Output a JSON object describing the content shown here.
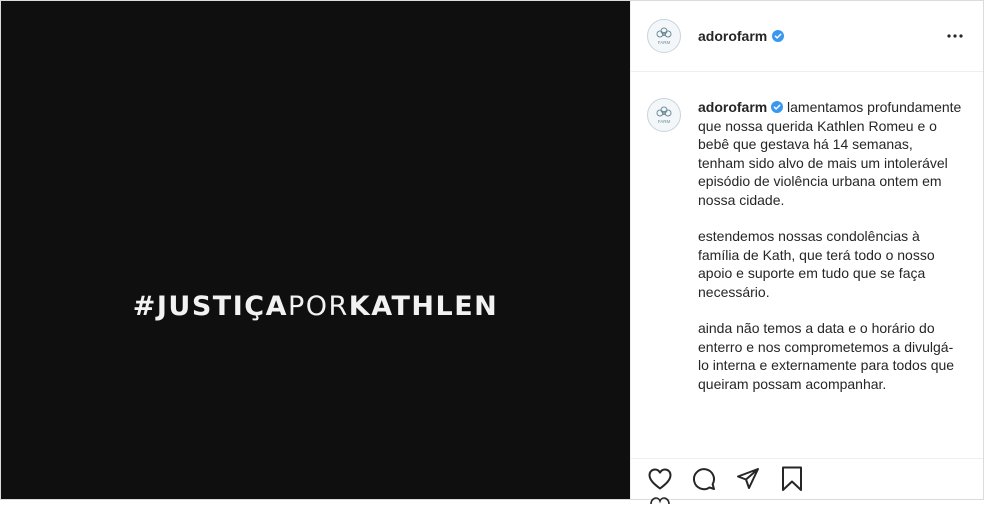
{
  "post": {
    "username": "adorofarm",
    "avatar_text": "FARM",
    "verified": true,
    "image_text_bold_1": "#JUSTIÇA",
    "image_text_thin": "POR",
    "image_text_bold_2": "KATHLEN",
    "caption_paragraphs": [
      "lamentamos profundamente que nossa querida Kathlen Romeu e o bebê que gestava há 14 semanas, tenham sido alvo de mais um intolerável episódio de violência urbana ontem em nossa cidade.",
      "estendemos nossas condolências à família de Kath, que terá todo o nosso apoio e suporte em tudo que se faça necessário.",
      "ainda não temos a data e o horário do enterro e nos comprometemos a divulgá-lo interna e externamente para todos que queiram possam acompanhar."
    ]
  },
  "colors": {
    "media_background": "#0f0f0f",
    "verified_badge": "#3897f0",
    "text": "#262626"
  },
  "icons": [
    "farm-flower-icon",
    "verified-badge-icon",
    "more-options-icon",
    "heart-icon",
    "comment-icon",
    "share-icon",
    "bookmark-icon"
  ]
}
